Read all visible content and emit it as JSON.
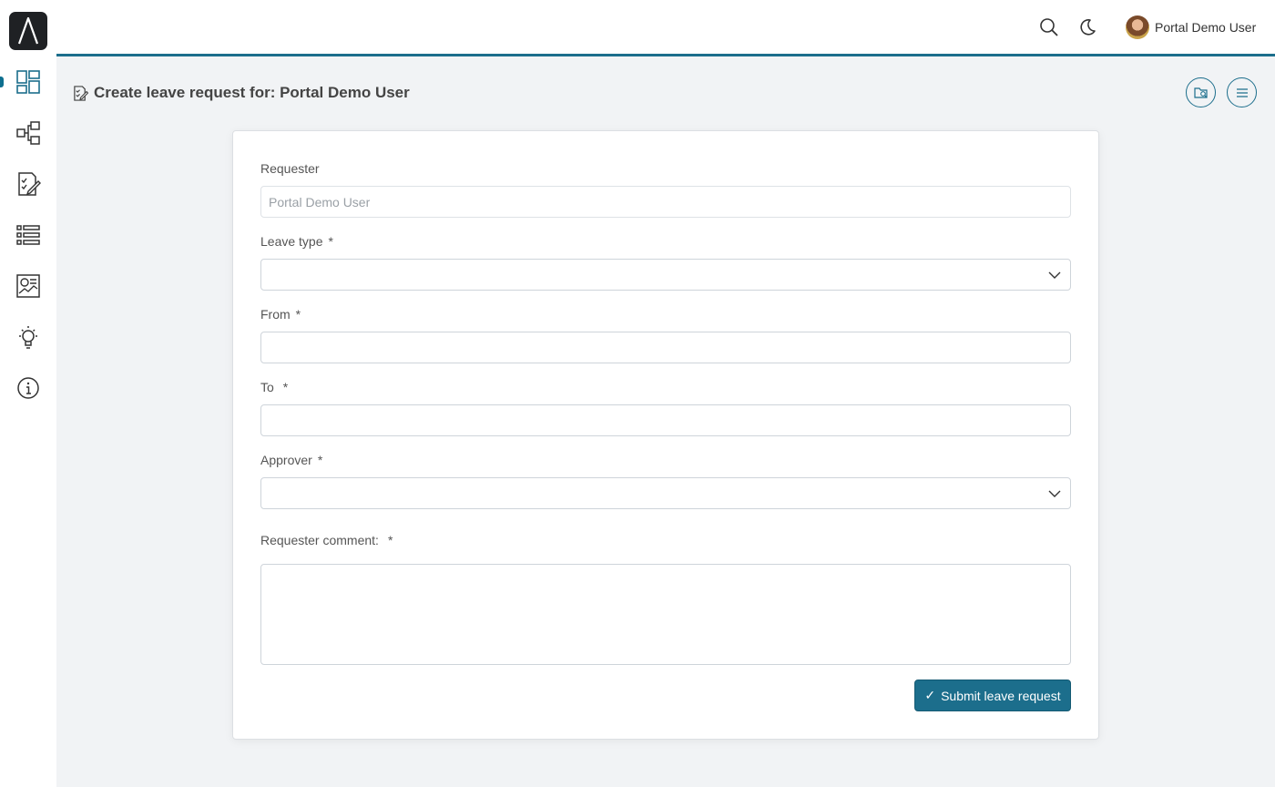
{
  "user": {
    "name": "Portal Demo User"
  },
  "page": {
    "title": "Create leave request for: Portal Demo User"
  },
  "form": {
    "requester": {
      "label": "Requester",
      "value": "Portal Demo User"
    },
    "leave_type": {
      "label": "Leave type",
      "required_mark": "*",
      "value": ""
    },
    "from": {
      "label": "From",
      "required_mark": "*",
      "value": ""
    },
    "to": {
      "label": "To",
      "required_mark": "*",
      "value": ""
    },
    "approver": {
      "label": "Approver",
      "required_mark": "*",
      "value": ""
    },
    "comment": {
      "label": "Requester comment:",
      "required_mark": "*",
      "value": ""
    },
    "submit": {
      "icon": "✓",
      "label": "Submit leave request"
    }
  },
  "sidebar": {
    "items": [
      {
        "icon": "dashboard-icon",
        "active": true
      },
      {
        "icon": "process-icon"
      },
      {
        "icon": "task-icon"
      },
      {
        "icon": "case-list-icon"
      },
      {
        "icon": "statistics-icon"
      },
      {
        "icon": "idea-icon"
      },
      {
        "icon": "info-icon"
      }
    ]
  },
  "colors": {
    "accent": "#1c6e8c",
    "background": "#f1f3f5",
    "sidebar": "#ffffff"
  }
}
